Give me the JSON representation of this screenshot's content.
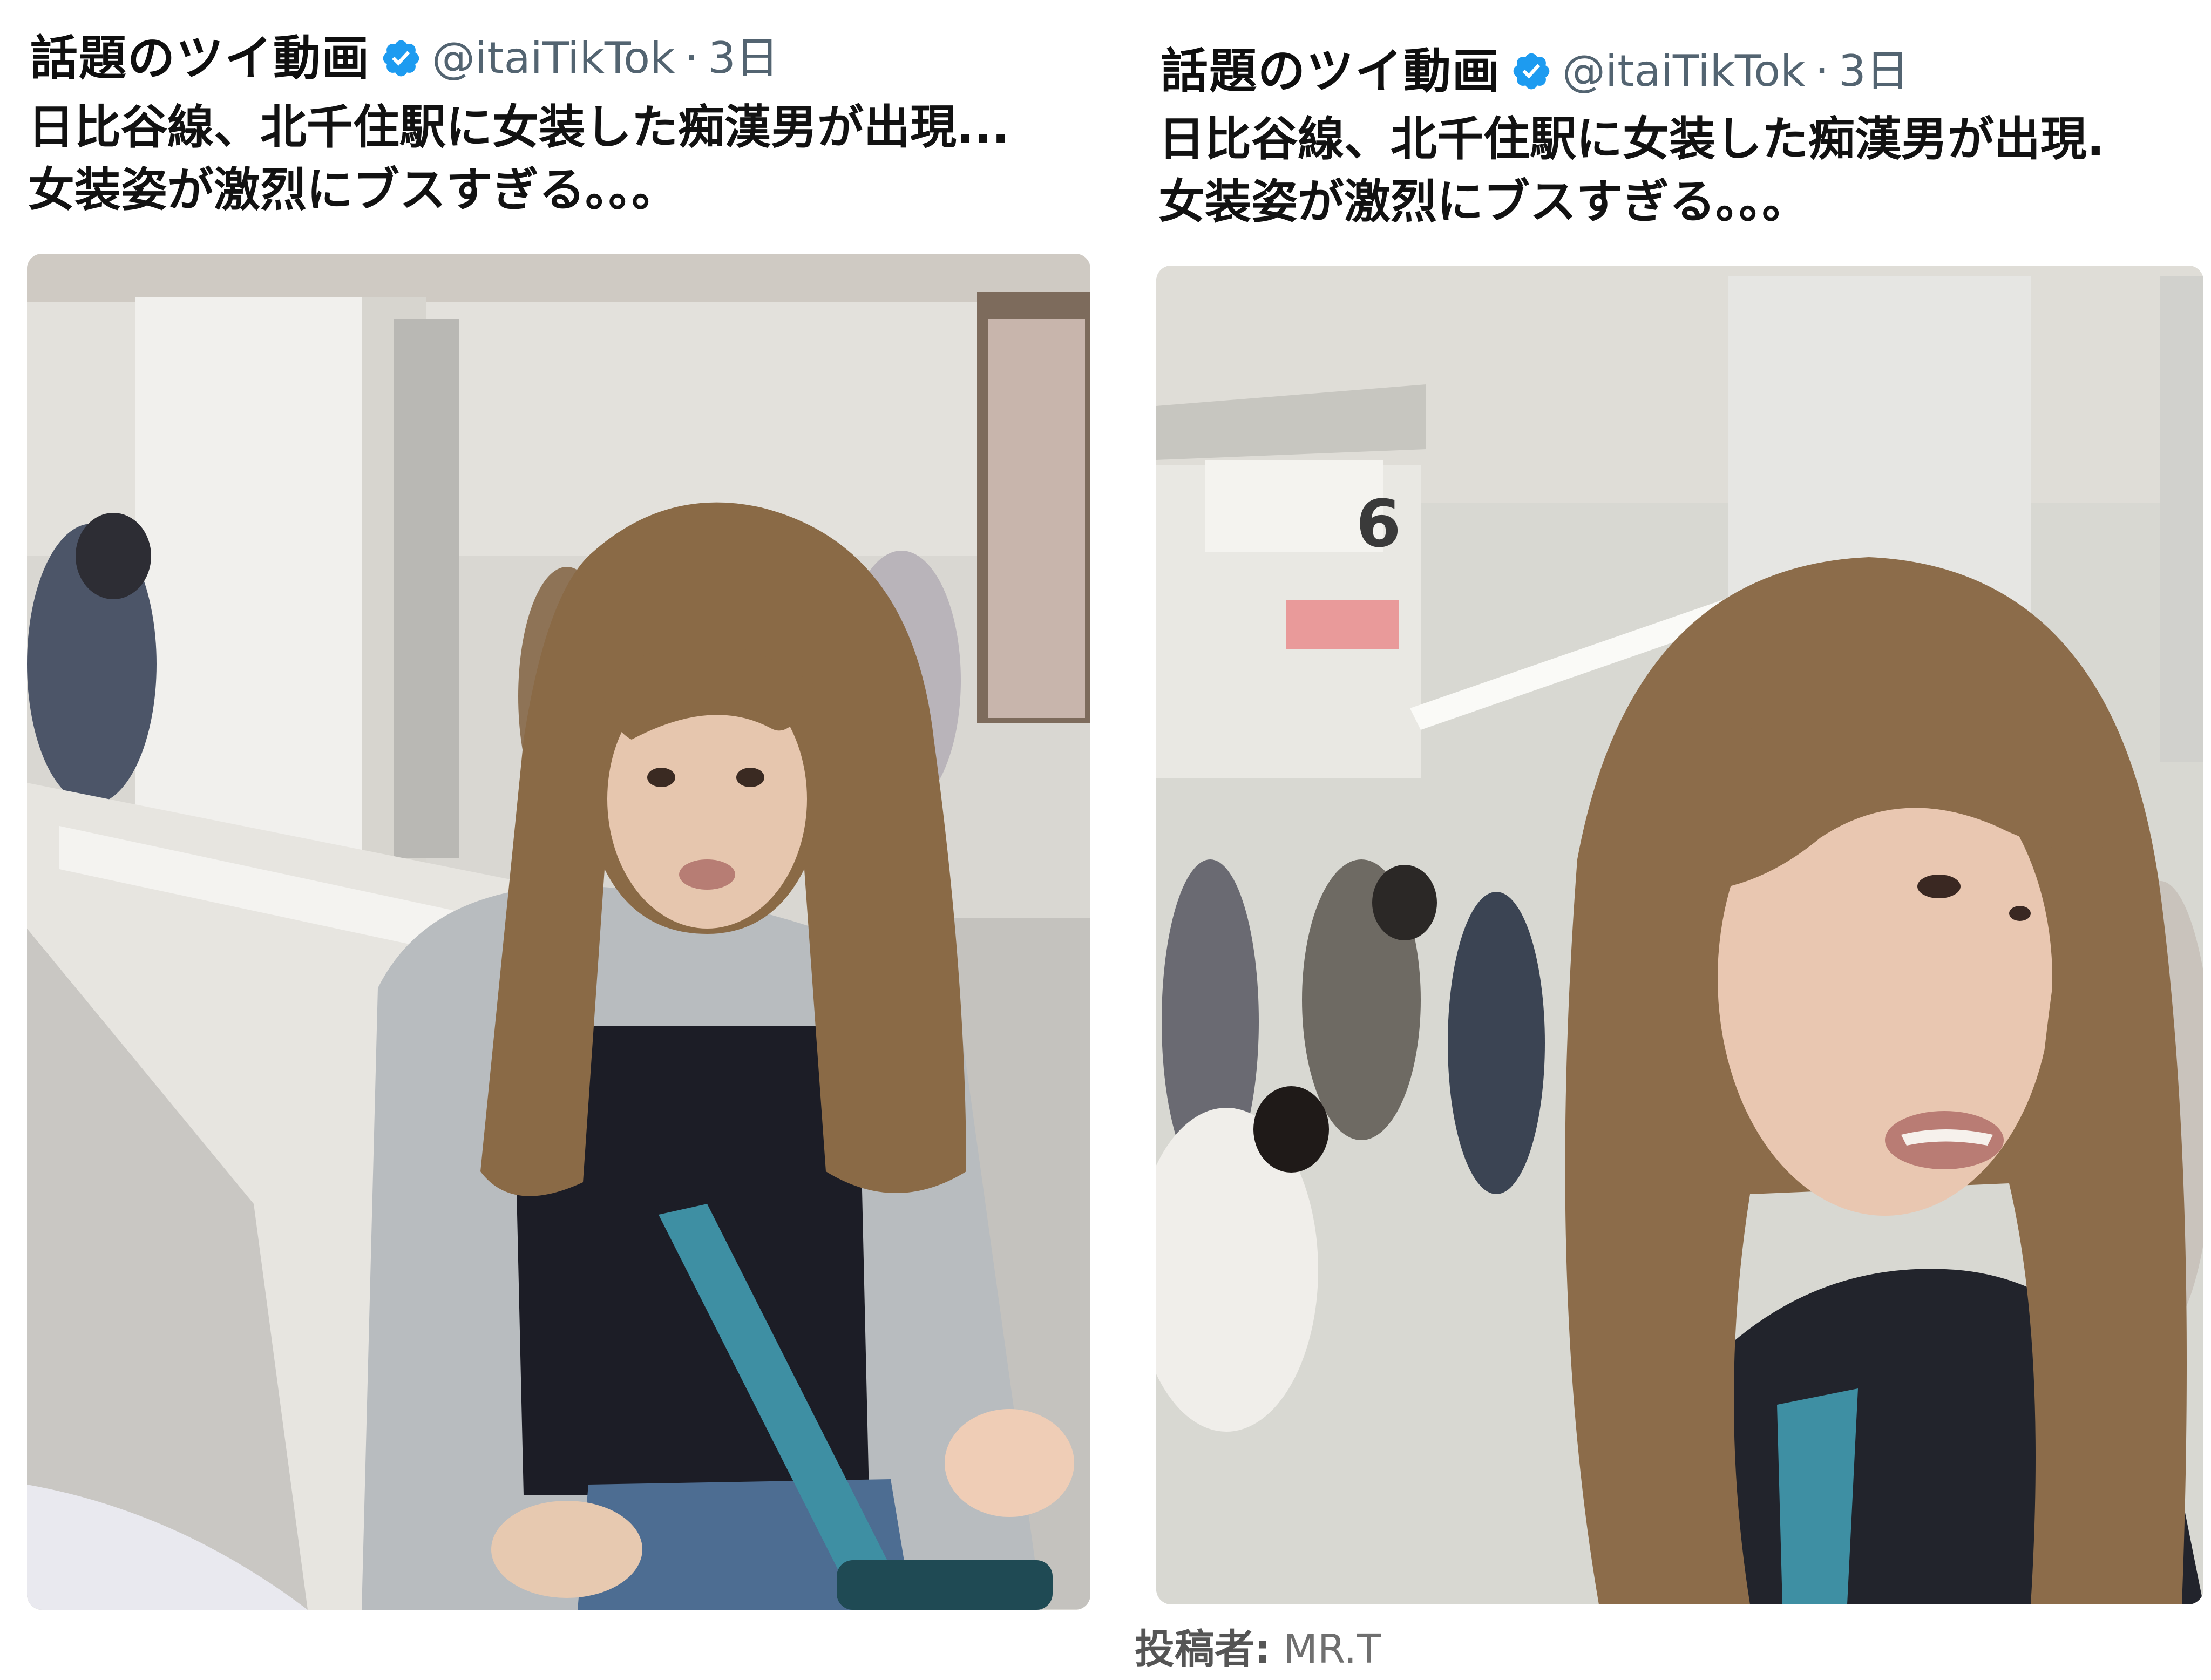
{
  "colors": {
    "verified_badge": "#1d9bf0",
    "handle_text": "#536471",
    "body_text": "#121212"
  },
  "left_post": {
    "account_name": "話題のツイ動画",
    "handle": "@itaiTikTok",
    "timestamp": "3日",
    "text_line_1": "日比谷線、北千住駅に女装した痴漢男が出現...",
    "text_line_2": "女装姿が激烈にブスすぎる。。。",
    "media_icon": "video-still-image"
  },
  "right_post": {
    "account_name": "話題のツイ動画",
    "handle": "@itaiTikTok",
    "timestamp": "3日",
    "text_line_1": "日比谷線、北千住駅に女装した痴漢男が出現.",
    "text_line_2": "女装姿が激烈にブスすぎる。。。",
    "media_icon": "video-still-image"
  },
  "credit": {
    "label": "投稿者:",
    "name": "MR.T"
  },
  "separator": "·"
}
